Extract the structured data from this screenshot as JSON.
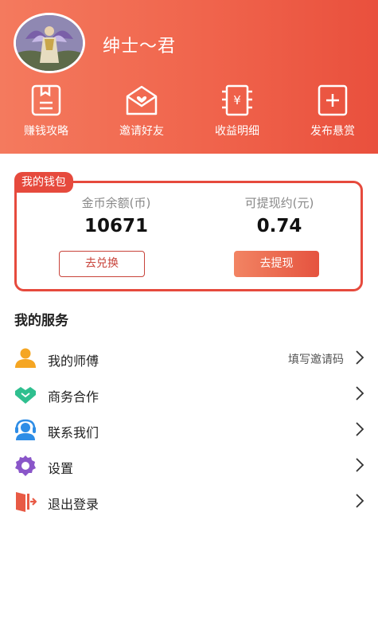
{
  "profile": {
    "username": "绅士～君"
  },
  "quick_actions": [
    {
      "label": "赚钱攻略",
      "icon": "guide-book-icon"
    },
    {
      "label": "邀请好友",
      "icon": "invite-envelope-icon"
    },
    {
      "label": "收益明细",
      "icon": "yuan-receipt-icon"
    },
    {
      "label": "发布悬赏",
      "icon": "plus-box-icon"
    }
  ],
  "wallet": {
    "tag": "我的钱包",
    "coins_label": "金币余额(币)",
    "coins_value": "10671",
    "cash_label": "可提现约(元)",
    "cash_value": "0.74",
    "exchange_button": "去兑换",
    "withdraw_button": "去提现"
  },
  "services": {
    "title": "我的服务",
    "items": [
      {
        "label": "我的师傅",
        "extra": "填写邀请码",
        "icon": "person-icon"
      },
      {
        "label": "商务合作",
        "extra": "",
        "icon": "handshake-icon"
      },
      {
        "label": "联系我们",
        "extra": "",
        "icon": "headset-icon"
      },
      {
        "label": "设置",
        "extra": "",
        "icon": "gear-icon"
      },
      {
        "label": "退出登录",
        "extra": "",
        "icon": "logout-door-icon"
      }
    ]
  },
  "colors": {
    "header_start": "#f47a5e",
    "header_end": "#e9503d",
    "accent": "#e64a3d",
    "icon_orange": "#f5a623",
    "icon_green": "#2fbf8f",
    "icon_blue": "#2e8de6",
    "icon_purple": "#8a56c9",
    "icon_red": "#e85a45"
  }
}
